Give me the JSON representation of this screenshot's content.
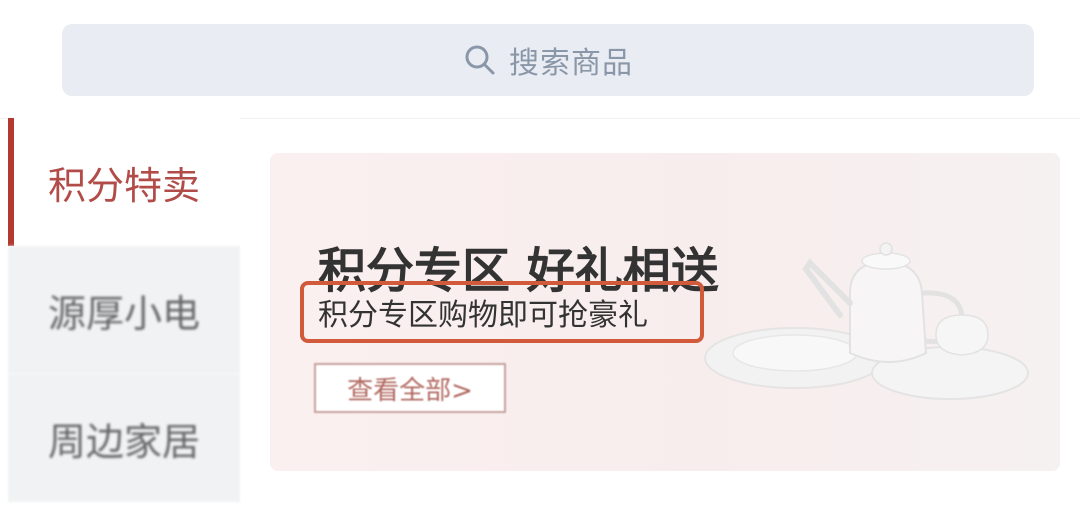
{
  "search": {
    "placeholder": "搜索商品"
  },
  "sidebar": {
    "items": [
      {
        "label": "积分特卖",
        "active": true
      },
      {
        "label": "源厚小电",
        "active": false
      },
      {
        "label": "周边家居",
        "active": false
      }
    ]
  },
  "banner": {
    "title": "积分专区 好礼相送",
    "subtitle": "积分专区购物即可抢豪礼",
    "button_label": "查看全部>"
  },
  "colors": {
    "accent": "#b23a30",
    "highlight_border": "#d05a3a",
    "search_bg": "#e9edf3",
    "banner_bg": "#f8eded"
  }
}
